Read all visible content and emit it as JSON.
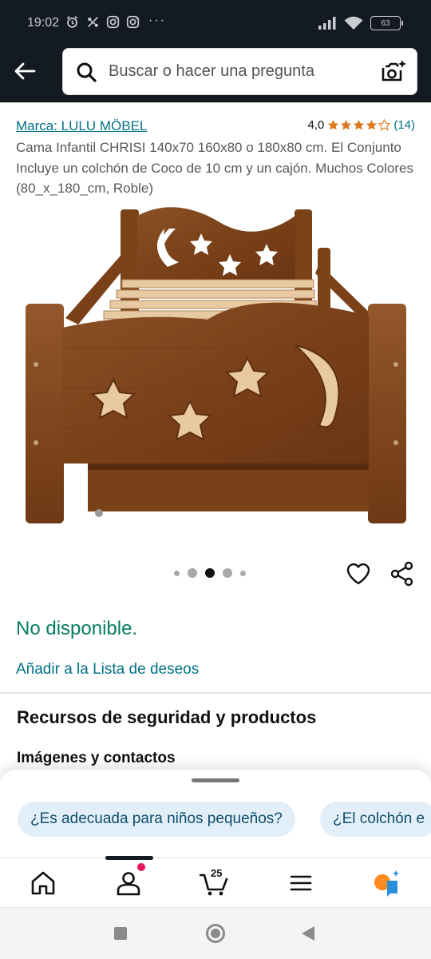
{
  "status_bar": {
    "time": "19:02",
    "icons": [
      "alarm-icon",
      "network-activity-icon",
      "instagram-icon",
      "instagram-icon"
    ],
    "more": "···",
    "battery": "63"
  },
  "header": {
    "search_placeholder": "Buscar o hacer una pregunta",
    "colors": {
      "background": "#131a22",
      "search_field": "#ffffff"
    }
  },
  "product": {
    "brand": "Marca: LULU MÖBEL",
    "rating_value": "4,0",
    "rating_stars": 4,
    "rating_count": "(14)",
    "title": "Cama Infantil CHRISI 140x70 160x80 o 180x80 cm. El Conjunto Incluye un colchón de Coco de 10 cm y un cajón. Muchos Colores (80_x_180_cm, Roble)",
    "image_count": 5,
    "image_active_index": 2,
    "availability": "No disponible.",
    "wishlist_link": "Añadir a la Lista de deseos"
  },
  "sections": {
    "safety_title": "Recursos de seguridad y productos",
    "images_contacts": "Imágenes y contactos"
  },
  "question_chips": [
    "¿Es adecuada para niños pequeños?",
    "¿El colchón e"
  ],
  "bottom_nav": {
    "items": [
      "home-icon",
      "account-icon",
      "cart-icon",
      "menu-icon",
      "rufus-icon"
    ],
    "cart_count": "25",
    "active_index": 1
  },
  "colors": {
    "link": "#007185",
    "availability": "#067d62",
    "star": "#de7921",
    "chip_bg": "#e2eff8"
  }
}
